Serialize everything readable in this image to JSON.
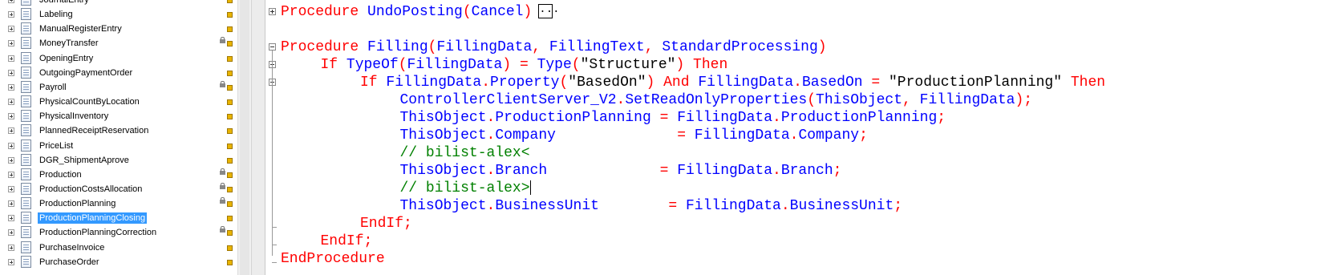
{
  "tree": {
    "items": [
      {
        "label": "JournalEntry",
        "locked": false,
        "selected": false
      },
      {
        "label": "Labeling",
        "locked": false,
        "selected": false
      },
      {
        "label": "ManualRegisterEntry",
        "locked": false,
        "selected": false
      },
      {
        "label": "MoneyTransfer",
        "locked": true,
        "selected": false
      },
      {
        "label": "OpeningEntry",
        "locked": false,
        "selected": false
      },
      {
        "label": "OutgoingPaymentOrder",
        "locked": false,
        "selected": false
      },
      {
        "label": "Payroll",
        "locked": true,
        "selected": false
      },
      {
        "label": "PhysicalCountByLocation",
        "locked": false,
        "selected": false
      },
      {
        "label": "PhysicalInventory",
        "locked": false,
        "selected": false
      },
      {
        "label": "PlannedReceiptReservation",
        "locked": false,
        "selected": false
      },
      {
        "label": "PriceList",
        "locked": false,
        "selected": false
      },
      {
        "label": "DGR_ShipmentAprove",
        "locked": false,
        "selected": false
      },
      {
        "label": "Production",
        "locked": true,
        "selected": false
      },
      {
        "label": "ProductionCostsAllocation",
        "locked": true,
        "selected": false
      },
      {
        "label": "ProductionPlanning",
        "locked": true,
        "selected": false
      },
      {
        "label": "ProductionPlanningClosing",
        "locked": false,
        "selected": true
      },
      {
        "label": "ProductionPlanningCorrection",
        "locked": true,
        "selected": false
      },
      {
        "label": "PurchaseInvoice",
        "locked": false,
        "selected": false
      },
      {
        "label": "PurchaseOrder",
        "locked": false,
        "selected": false
      }
    ]
  },
  "code": {
    "lines": [
      {
        "indent": 0,
        "tokens": [
          {
            "t": "Procedure ",
            "c": "kw"
          },
          {
            "t": "UndoPosting",
            "c": "id"
          },
          {
            "t": "(",
            "c": "op"
          },
          {
            "t": "Cancel",
            "c": "id"
          },
          {
            "t": ")",
            "c": "op"
          }
        ],
        "ellipsis": "..."
      },
      {
        "indent": 0,
        "tokens": []
      },
      {
        "indent": 0,
        "tokens": [
          {
            "t": "Procedure ",
            "c": "kw"
          },
          {
            "t": "Filling",
            "c": "id"
          },
          {
            "t": "(",
            "c": "op"
          },
          {
            "t": "FillingData",
            "c": "id"
          },
          {
            "t": ", ",
            "c": "op"
          },
          {
            "t": "FillingText",
            "c": "id"
          },
          {
            "t": ", ",
            "c": "op"
          },
          {
            "t": "StandardProcessing",
            "c": "id"
          },
          {
            "t": ")",
            "c": "op"
          }
        ]
      },
      {
        "indent": 1,
        "tokens": [
          {
            "t": "If ",
            "c": "kw"
          },
          {
            "t": "TypeOf",
            "c": "id"
          },
          {
            "t": "(",
            "c": "op"
          },
          {
            "t": "FillingData",
            "c": "id"
          },
          {
            "t": ") = ",
            "c": "op"
          },
          {
            "t": "Type",
            "c": "id"
          },
          {
            "t": "(",
            "c": "op"
          },
          {
            "t": "\"Structure\"",
            "c": "str"
          },
          {
            "t": ") ",
            "c": "op"
          },
          {
            "t": "Then",
            "c": "kw"
          }
        ]
      },
      {
        "indent": 2,
        "tokens": [
          {
            "t": "If ",
            "c": "kw"
          },
          {
            "t": "FillingData",
            "c": "id"
          },
          {
            "t": ".",
            "c": "op"
          },
          {
            "t": "Property",
            "c": "id"
          },
          {
            "t": "(",
            "c": "op"
          },
          {
            "t": "\"BasedOn\"",
            "c": "str"
          },
          {
            "t": ") ",
            "c": "op"
          },
          {
            "t": "And ",
            "c": "kw"
          },
          {
            "t": "FillingData",
            "c": "id"
          },
          {
            "t": ".",
            "c": "op"
          },
          {
            "t": "BasedOn",
            "c": "id"
          },
          {
            "t": " = ",
            "c": "op"
          },
          {
            "t": "\"ProductionPlanning\"",
            "c": "str"
          },
          {
            "t": " ",
            "c": "op"
          },
          {
            "t": "Then",
            "c": "kw"
          }
        ]
      },
      {
        "indent": 3,
        "tokens": [
          {
            "t": "ControllerClientServer_V2",
            "c": "id"
          },
          {
            "t": ".",
            "c": "op"
          },
          {
            "t": "SetReadOnlyProperties",
            "c": "id"
          },
          {
            "t": "(",
            "c": "op"
          },
          {
            "t": "ThisObject",
            "c": "id"
          },
          {
            "t": ", ",
            "c": "op"
          },
          {
            "t": "FillingData",
            "c": "id"
          },
          {
            "t": ");",
            "c": "op"
          }
        ]
      },
      {
        "indent": 3,
        "tokens": [
          {
            "t": "ThisObject",
            "c": "id"
          },
          {
            "t": ".",
            "c": "op"
          },
          {
            "t": "ProductionPlanning",
            "c": "id"
          },
          {
            "t": " = ",
            "c": "op"
          },
          {
            "t": "FillingData",
            "c": "id"
          },
          {
            "t": ".",
            "c": "op"
          },
          {
            "t": "ProductionPlanning",
            "c": "id"
          },
          {
            "t": ";",
            "c": "op"
          }
        ]
      },
      {
        "indent": 3,
        "tokens": [
          {
            "t": "ThisObject",
            "c": "id"
          },
          {
            "t": ".",
            "c": "op"
          },
          {
            "t": "Company",
            "c": "id"
          },
          {
            "t": "              = ",
            "c": "op"
          },
          {
            "t": "FillingData",
            "c": "id"
          },
          {
            "t": ".",
            "c": "op"
          },
          {
            "t": "Company",
            "c": "id"
          },
          {
            "t": ";",
            "c": "op"
          }
        ]
      },
      {
        "indent": 3,
        "tokens": [
          {
            "t": "// bilist-alex<",
            "c": "cm"
          }
        ]
      },
      {
        "indent": 3,
        "tokens": [
          {
            "t": "ThisObject",
            "c": "id"
          },
          {
            "t": ".",
            "c": "op"
          },
          {
            "t": "Branch",
            "c": "id"
          },
          {
            "t": "             = ",
            "c": "op"
          },
          {
            "t": "FillingData",
            "c": "id"
          },
          {
            "t": ".",
            "c": "op"
          },
          {
            "t": "Branch",
            "c": "id"
          },
          {
            "t": ";",
            "c": "op"
          }
        ]
      },
      {
        "indent": 3,
        "tokens": [
          {
            "t": "// bilist-alex>",
            "c": "cm"
          }
        ],
        "caret": true
      },
      {
        "indent": 3,
        "tokens": [
          {
            "t": "ThisObject",
            "c": "id"
          },
          {
            "t": ".",
            "c": "op"
          },
          {
            "t": "BusinessUnit",
            "c": "id"
          },
          {
            "t": "        = ",
            "c": "op"
          },
          {
            "t": "FillingData",
            "c": "id"
          },
          {
            "t": ".",
            "c": "op"
          },
          {
            "t": "BusinessUnit",
            "c": "id"
          },
          {
            "t": ";",
            "c": "op"
          }
        ]
      },
      {
        "indent": 2,
        "tokens": [
          {
            "t": "EndIf;",
            "c": "kw"
          }
        ]
      },
      {
        "indent": 1,
        "tokens": [
          {
            "t": "EndIf;",
            "c": "kw"
          }
        ]
      },
      {
        "indent": 0,
        "tokens": [
          {
            "t": "EndProcedure",
            "c": "kw"
          }
        ]
      }
    ]
  }
}
